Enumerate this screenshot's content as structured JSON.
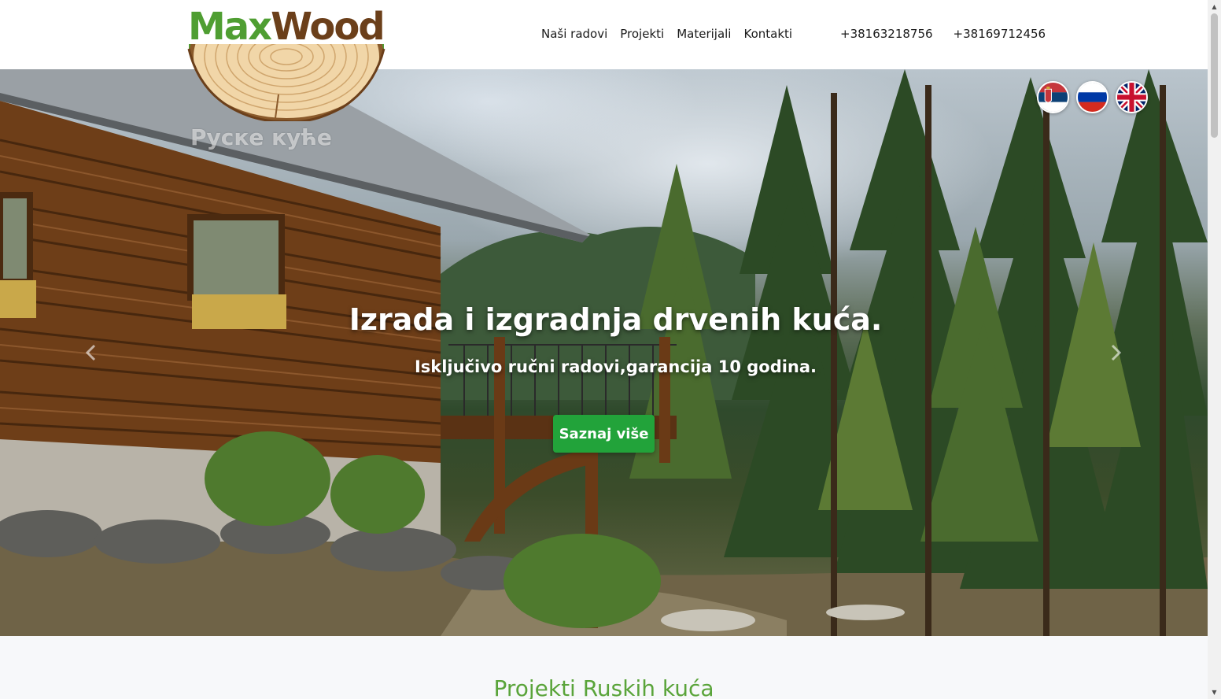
{
  "logo": {
    "part1": "Max",
    "part2": "Wood"
  },
  "nav": {
    "items": [
      {
        "label": "Naši radovi"
      },
      {
        "label": "Projekti"
      },
      {
        "label": "Materijali"
      },
      {
        "label": "Kontakti"
      }
    ],
    "phones": [
      "+38163218756",
      "+38169712456"
    ]
  },
  "languages": [
    {
      "icon": "serbia-flag-icon"
    },
    {
      "icon": "russia-flag-icon"
    },
    {
      "icon": "uk-flag-icon"
    }
  ],
  "hero": {
    "watermark": "Руске куће",
    "title": "Izrada i izgradnja drvenih kuća.",
    "subtitle": "Isključivo ručni radovi,garancija 10 godina.",
    "cta_label": "Saznaj više",
    "prev_icon": "chevron-left-icon",
    "next_icon": "chevron-right-icon"
  },
  "section": {
    "title": "Projekti Ruskih kuća"
  },
  "colors": {
    "brand_green": "#4f9e32",
    "brand_brown": "#6b3f1a",
    "cta_green": "#22a33a",
    "section_title": "#5aa43a"
  }
}
